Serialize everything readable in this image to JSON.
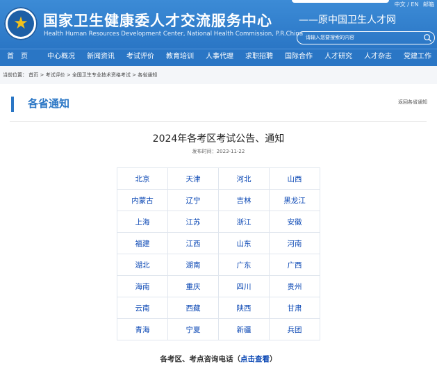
{
  "header": {
    "top_links": [
      "中文 / EN",
      "邮箱"
    ],
    "title": "国家卫生健康委人才交流服务中心",
    "subtitle_en": "Health Human Resources Development Center, National Health Commission, P.R.China",
    "former_name": "——原中国卫生人才网",
    "search_placeholder": "请输入您要搜索的内容",
    "search_icon": "search-icon",
    "logo_icon": "emblem-logo-icon",
    "accent": "#2a76c5"
  },
  "nav": {
    "items": [
      "首　页",
      "中心概况",
      "新闻资讯",
      "考试评价",
      "教育培训",
      "人事代理",
      "求职招聘",
      "国际合作",
      "人才研究",
      "人才杂志",
      "党建工作"
    ]
  },
  "breadcrumb": {
    "prefix": "当前位置：",
    "items": [
      "首页",
      "考试评价",
      "全国卫生专业技术资格考试",
      "各省通知"
    ],
    "separator": ">"
  },
  "section": {
    "title": "各省通知",
    "back_link": "返回各省通知"
  },
  "article": {
    "title": "2024年各考区考试公告、通知",
    "date": "发布时间：2023-11-22"
  },
  "provinces": [
    [
      "北京",
      "天津",
      "河北",
      "山西"
    ],
    [
      "内蒙古",
      "辽宁",
      "吉林",
      "黑龙江"
    ],
    [
      "上海",
      "江苏",
      "浙江",
      "安徽"
    ],
    [
      "福建",
      "江西",
      "山东",
      "河南"
    ],
    [
      "湖北",
      "湖南",
      "广东",
      "广西"
    ],
    [
      "海南",
      "重庆",
      "四川",
      "贵州"
    ],
    [
      "云南",
      "西藏",
      "陕西",
      "甘肃"
    ],
    [
      "青海",
      "宁夏",
      "新疆",
      "兵团"
    ]
  ],
  "consult": {
    "text": "各考区、考点咨询电话（",
    "link": "点击查看",
    "close": "）"
  }
}
